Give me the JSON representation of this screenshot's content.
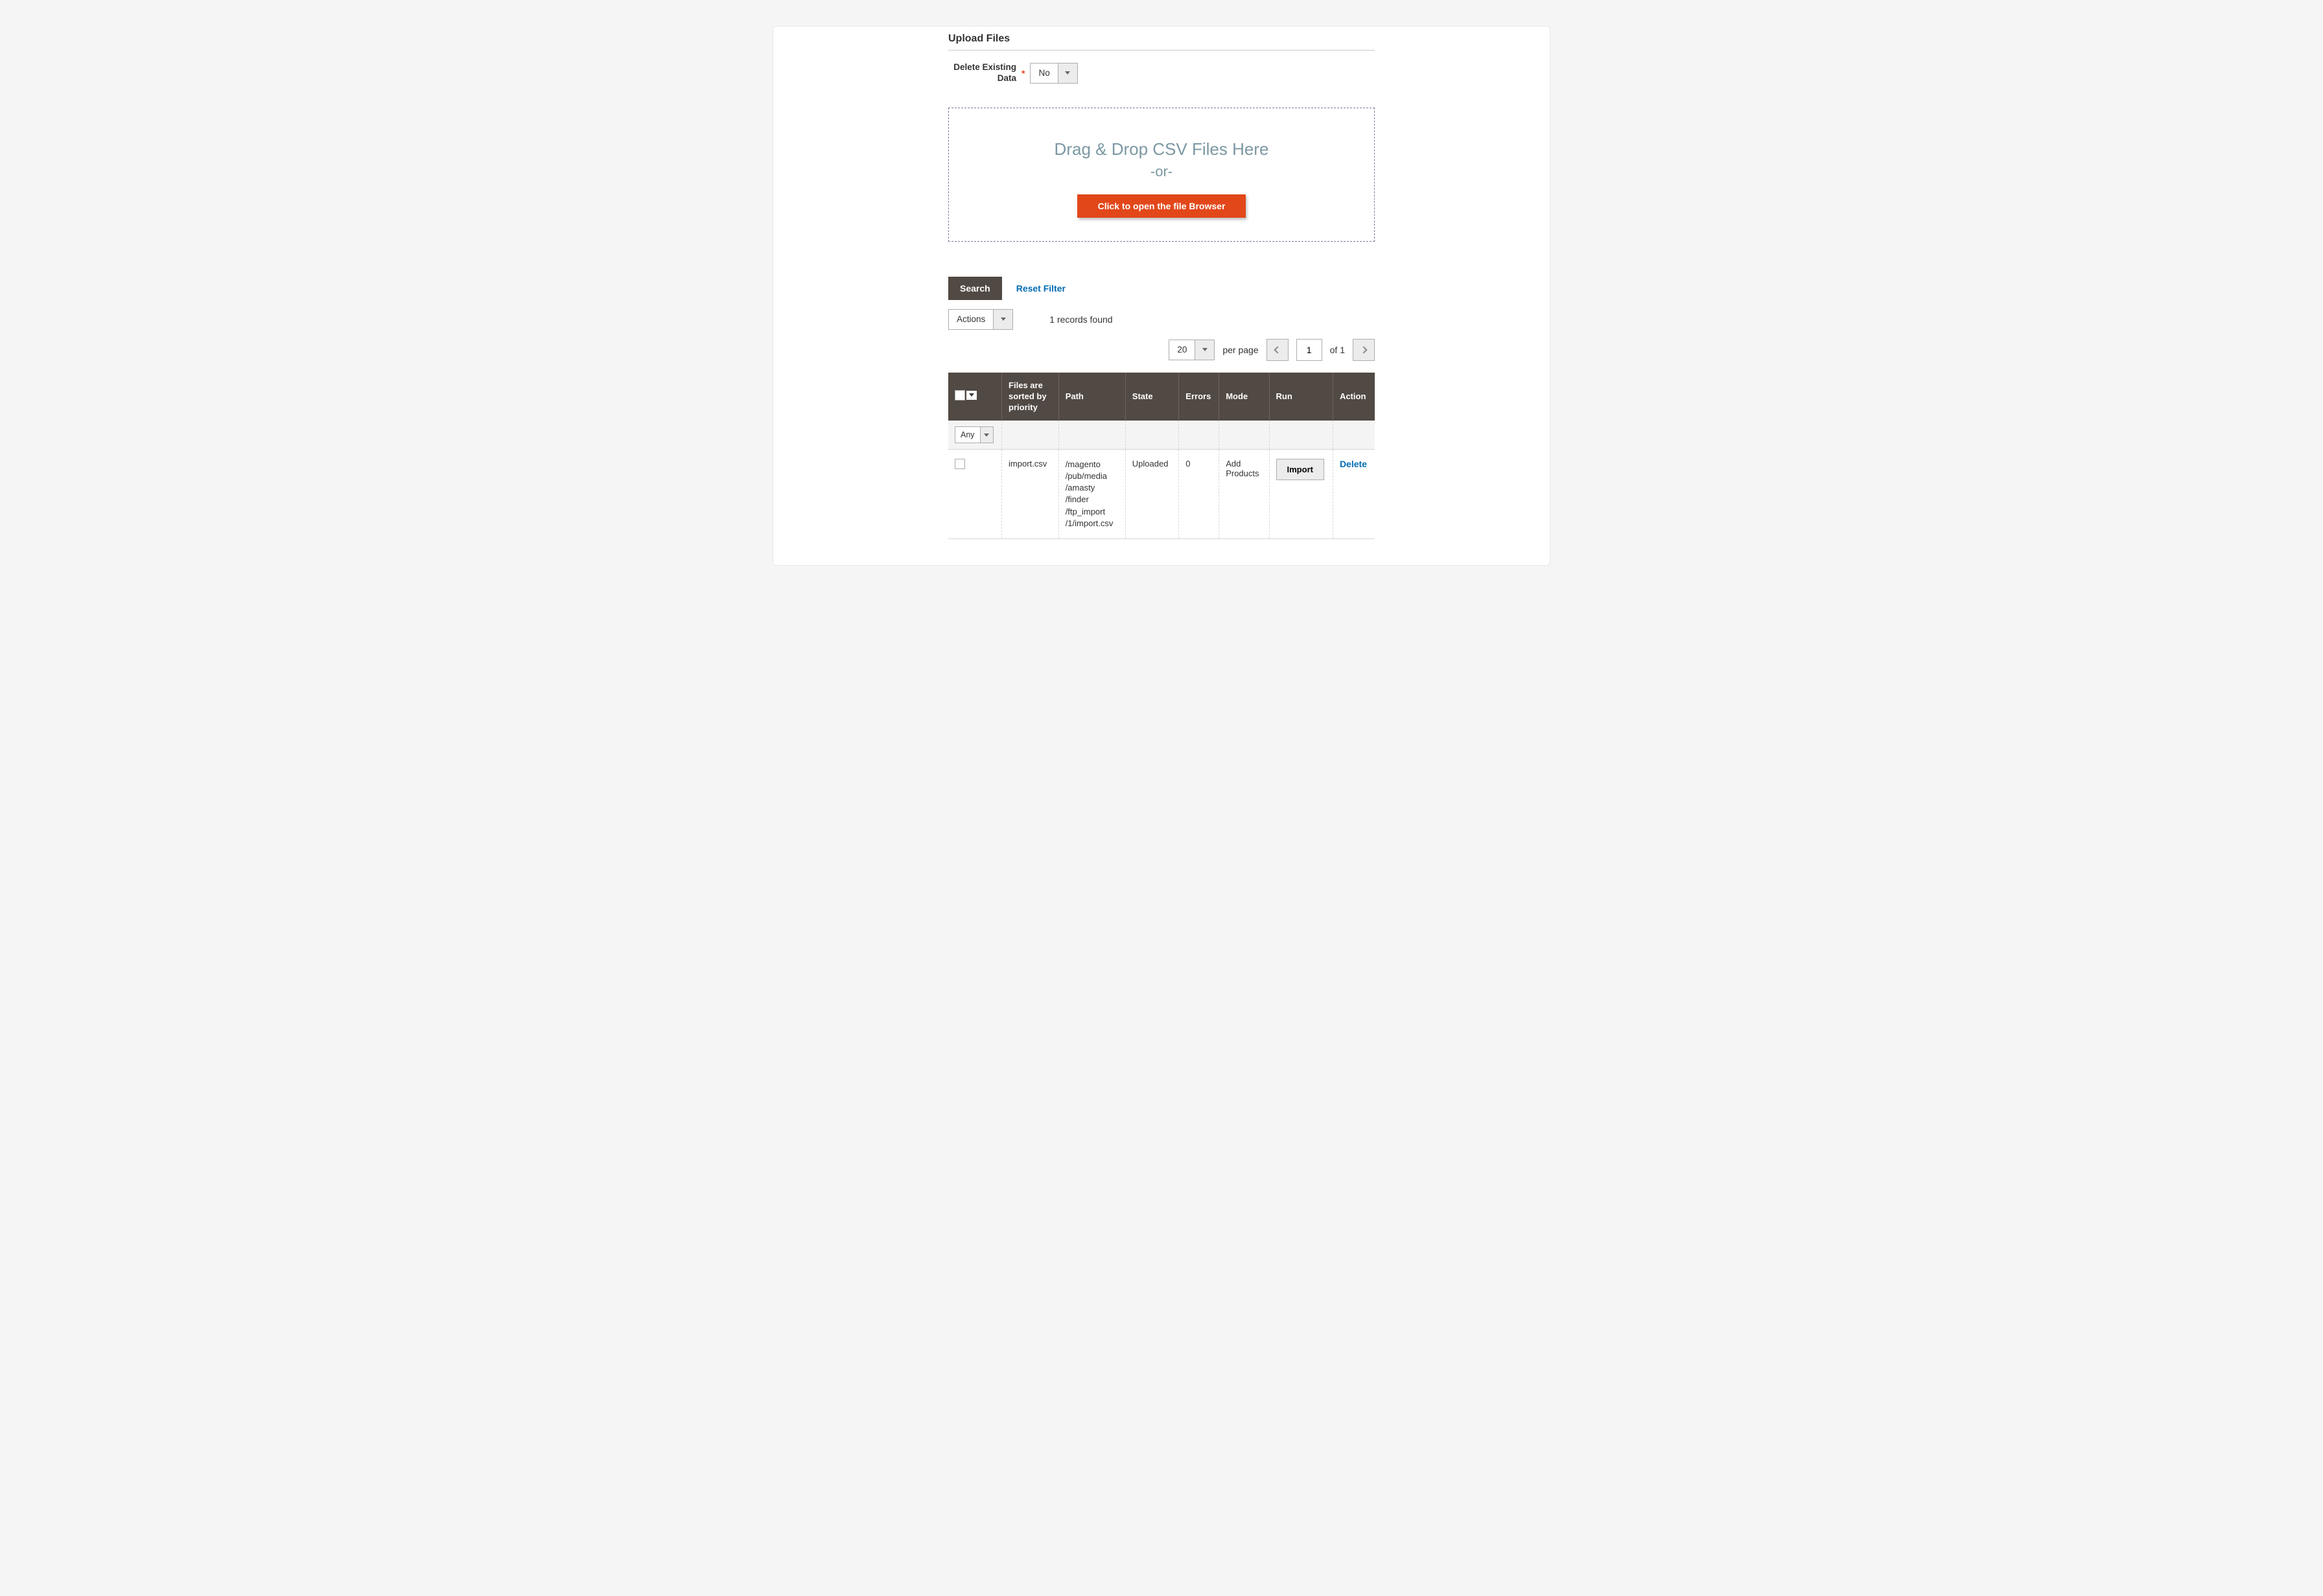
{
  "section": {
    "title": "Upload Files",
    "delete_label": "Delete Existing Data",
    "delete_value": "No"
  },
  "dropzone": {
    "title": "Drag & Drop CSV Files Here",
    "or": "-or-",
    "button": "Click to open the file Browser"
  },
  "toolbar": {
    "search": "Search",
    "reset": "Reset Filter",
    "actions": "Actions",
    "records_found": "1 records found",
    "per_page_value": "20",
    "per_page_label": "per page",
    "page_value": "1",
    "page_of": "of 1"
  },
  "table": {
    "headers": {
      "files": "Files are sorted by priority",
      "path": "Path",
      "state": "State",
      "errors": "Errors",
      "mode": "Mode",
      "run": "Run",
      "action": "Action"
    },
    "filter_any": "Any",
    "row": {
      "file": "import.csv",
      "path": "/magento /pub/media /amasty /finder /ftp_import /1/import.csv",
      "state": "Uploaded",
      "errors": "0",
      "mode": "Add Products",
      "run_label": "Import",
      "action_label": "Delete"
    }
  }
}
